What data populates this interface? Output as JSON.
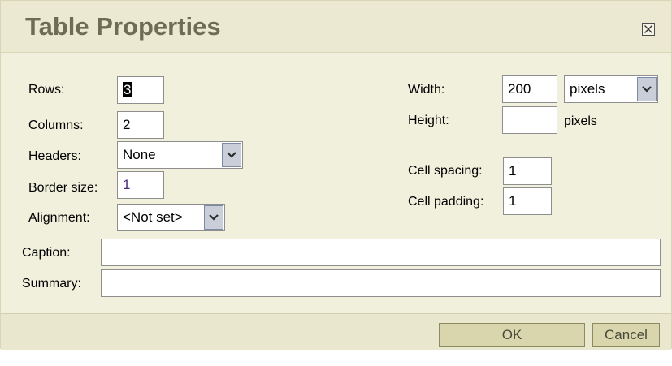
{
  "dialog": {
    "title": "Table Properties",
    "close_icon": "close-box-icon"
  },
  "left": {
    "rows_label": "Rows:",
    "rows_value": "3",
    "columns_label": "Columns:",
    "columns_value": "2",
    "headers_label": "Headers:",
    "headers_value": "None",
    "border_label": "Border size:",
    "border_value": "1",
    "alignment_label": "Alignment:",
    "alignment_value": "<Not set>"
  },
  "right": {
    "width_label": "Width:",
    "width_value": "200",
    "width_unit": "pixels",
    "height_label": "Height:",
    "height_value": "",
    "height_unit": "pixels",
    "spacing_label": "Cell spacing:",
    "spacing_value": "1",
    "padding_label": "Cell padding:",
    "padding_value": "1"
  },
  "bottom": {
    "caption_label": "Caption:",
    "caption_value": "",
    "summary_label": "Summary:",
    "summary_value": ""
  },
  "footer": {
    "ok_label": "OK",
    "cancel_label": "Cancel"
  }
}
